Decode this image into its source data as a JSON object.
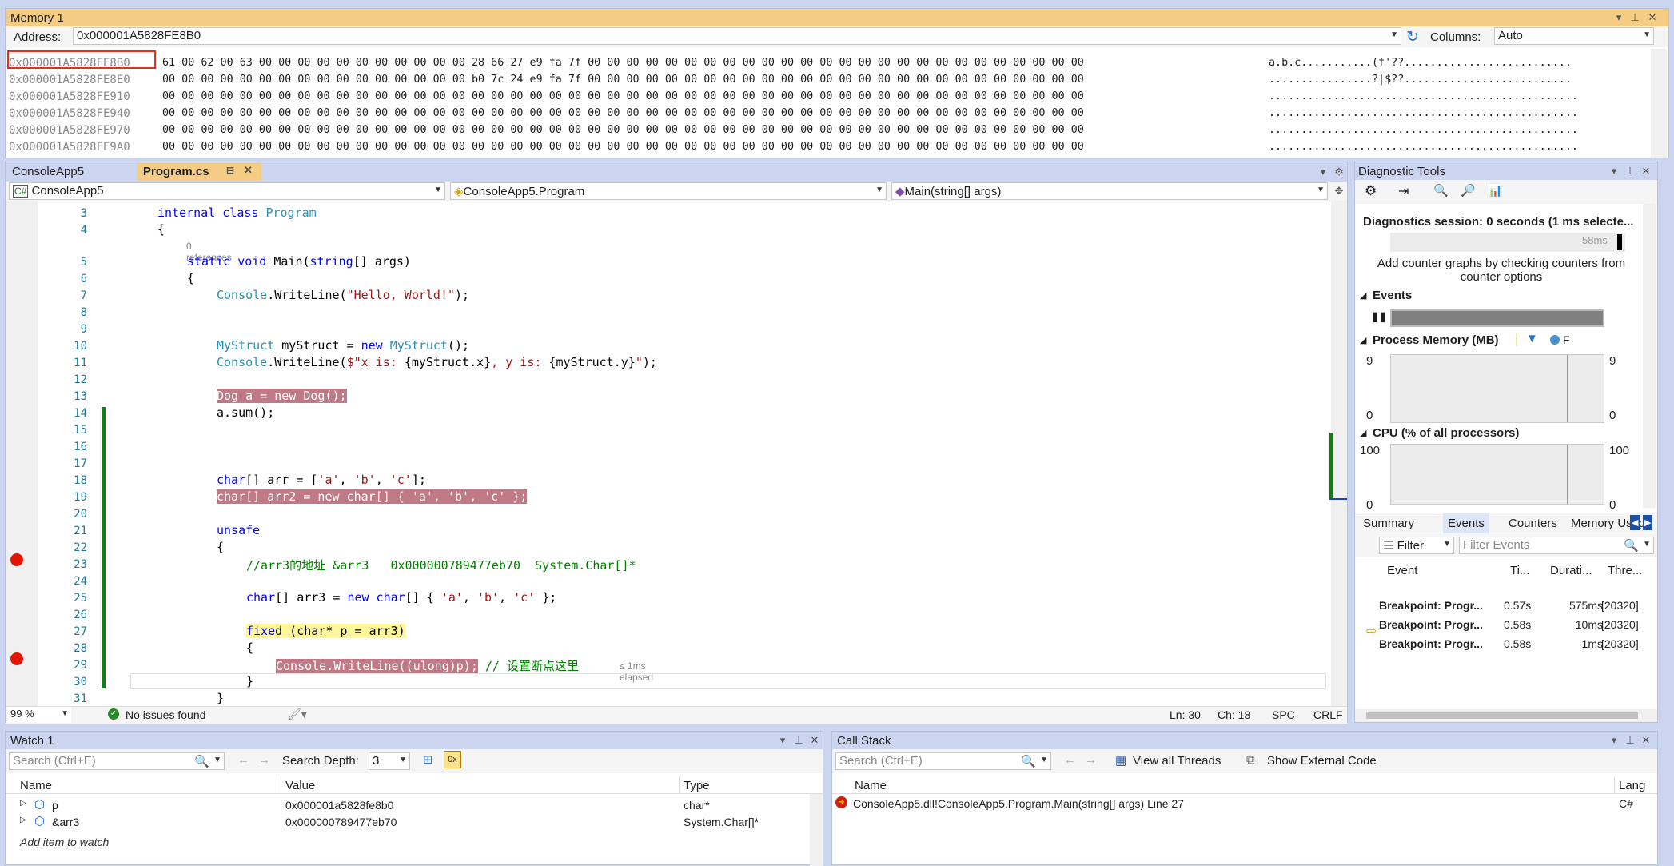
{
  "memory": {
    "title": "Memory 1",
    "address_label": "Address:",
    "address_value": "0x000001A5828FE8B0",
    "columns_label": "Columns:",
    "columns_value": "Auto",
    "rows": [
      {
        "addr": "0x000001A5828FE8B0",
        "bytes": "61 00 62 00 63 00 00 00 00 00 00 00 00 00 00 00 28 66 27 e9 fa 7f 00 00 00 00 00 00 00 00 00 00 00 00 00 00 00 00 00 00 00 00 00 00 00 00 00 00",
        "ascii": "a.b.c...........(f'??.........................."
      },
      {
        "addr": "0x000001A5828FE8E0",
        "bytes": "00 00 00 00 00 00 00 00 00 00 00 00 00 00 00 00 b0 7c 24 e9 fa 7f 00 00 00 00 00 00 00 00 00 00 00 00 00 00 00 00 00 00 00 00 00 00 00 00 00 00",
        "ascii": "................?|$??.........................."
      },
      {
        "addr": "0x000001A5828FE910",
        "bytes": "00 00 00 00 00 00 00 00 00 00 00 00 00 00 00 00 00 00 00 00 00 00 00 00 00 00 00 00 00 00 00 00 00 00 00 00 00 00 00 00 00 00 00 00 00 00 00 00",
        "ascii": "................................................"
      },
      {
        "addr": "0x000001A5828FE940",
        "bytes": "00 00 00 00 00 00 00 00 00 00 00 00 00 00 00 00 00 00 00 00 00 00 00 00 00 00 00 00 00 00 00 00 00 00 00 00 00 00 00 00 00 00 00 00 00 00 00 00",
        "ascii": "................................................"
      },
      {
        "addr": "0x000001A5828FE970",
        "bytes": "00 00 00 00 00 00 00 00 00 00 00 00 00 00 00 00 00 00 00 00 00 00 00 00 00 00 00 00 00 00 00 00 00 00 00 00 00 00 00 00 00 00 00 00 00 00 00 00",
        "ascii": "................................................"
      },
      {
        "addr": "0x000001A5828FE9A0",
        "bytes": "00 00 00 00 00 00 00 00 00 00 00 00 00 00 00 00 00 00 00 00 00 00 00 00 00 00 00 00 00 00 00 00 00 00 00 00 00 00 00 00 00 00 00 00 00 00 00 00",
        "ascii": "................................................"
      }
    ]
  },
  "editor": {
    "tabs": [
      {
        "label": "ConsoleApp5"
      },
      {
        "label": "Program.cs"
      }
    ],
    "nav_project": "ConsoleApp5",
    "nav_class": "ConsoleApp5.Program",
    "nav_member": "Main(string[] args)",
    "references": "0 references",
    "elapsed": "≤ 1ms elapsed",
    "zoom": "99 %",
    "issues": "No issues found",
    "ln": "Ln: 30",
    "ch": "Ch: 18",
    "spc": "SPC",
    "crlf": "CRLF",
    "lines": [
      {
        "n": "3",
        "parts": [
          [
            "kw",
            "internal class "
          ],
          [
            "ty",
            "Program"
          ]
        ],
        "indent": 0
      },
      {
        "n": "4",
        "parts": [
          [
            "",
            "{"
          ]
        ],
        "indent": 0
      },
      {
        "n": "5",
        "parts": [
          [
            "kw",
            "static void "
          ],
          [
            "",
            "Main("
          ],
          [
            "kw",
            "string"
          ],
          [
            "",
            "[] args)"
          ]
        ],
        "indent": 1
      },
      {
        "n": "6",
        "parts": [
          [
            "",
            "{"
          ]
        ],
        "indent": 1
      },
      {
        "n": "7",
        "parts": [
          [
            "ty",
            "Console"
          ],
          [
            "",
            ".WriteLine("
          ],
          [
            "st",
            "\"Hello, World!\""
          ],
          [
            "",
            ");"
          ]
        ],
        "indent": 2
      },
      {
        "n": "8",
        "parts": [],
        "indent": 2
      },
      {
        "n": "9",
        "parts": [],
        "indent": 2
      },
      {
        "n": "10",
        "parts": [
          [
            "ty",
            "MyStruct"
          ],
          [
            "",
            " myStruct = "
          ],
          [
            "kw",
            "new "
          ],
          [
            "ty",
            "MyStruct"
          ],
          [
            "",
            "();"
          ]
        ],
        "indent": 2
      },
      {
        "n": "11",
        "parts": [
          [
            "ty",
            "Console"
          ],
          [
            "",
            ".WriteLine("
          ],
          [
            "st",
            "$\"x is: "
          ],
          [
            "",
            "{myStruct.x}"
          ],
          [
            "st",
            ", y is: "
          ],
          [
            "",
            "{myStruct.y}"
          ],
          [
            "st",
            "\""
          ],
          [
            "",
            ");"
          ]
        ],
        "indent": 2
      },
      {
        "n": "12",
        "parts": [],
        "indent": 2
      },
      {
        "n": "13",
        "parts": [
          [
            "bpline",
            "Dog a = new Dog();"
          ]
        ],
        "indent": 2
      },
      {
        "n": "14",
        "parts": [
          [
            "",
            "a.sum();"
          ]
        ],
        "indent": 2
      },
      {
        "n": "15",
        "parts": [],
        "indent": 2
      },
      {
        "n": "16",
        "parts": [],
        "indent": 2
      },
      {
        "n": "17",
        "parts": [],
        "indent": 2
      },
      {
        "n": "18",
        "parts": [
          [
            "kw",
            "char"
          ],
          [
            "",
            "[] arr = ["
          ],
          [
            "st",
            "'a'"
          ],
          [
            ", ",
            ", "
          ],
          [
            "st",
            "'b'"
          ],
          [
            "",
            ", "
          ],
          [
            "st",
            "'c'"
          ],
          [
            "",
            "];"
          ]
        ],
        "indent": 2
      },
      {
        "n": "19",
        "parts": [
          [
            "bpline",
            "char[] arr2 = new char[] { 'a', 'b', 'c' };"
          ]
        ],
        "indent": 2
      },
      {
        "n": "20",
        "parts": [],
        "indent": 2
      },
      {
        "n": "21",
        "parts": [
          [
            "kw",
            "unsafe"
          ]
        ],
        "indent": 2
      },
      {
        "n": "22",
        "parts": [
          [
            "",
            "{"
          ]
        ],
        "indent": 2
      },
      {
        "n": "23",
        "parts": [
          [
            "cm",
            "//arr3的地址 &arr3   0x000000789477eb70  System.Char[]*"
          ]
        ],
        "indent": 3
      },
      {
        "n": "24",
        "parts": [],
        "indent": 3
      },
      {
        "n": "25",
        "parts": [
          [
            "kw",
            "char"
          ],
          [
            "",
            "[] arr3 = "
          ],
          [
            "kw",
            "new char"
          ],
          [
            "",
            "[] { "
          ],
          [
            "st",
            "'a'"
          ],
          [
            "",
            ", "
          ],
          [
            "st",
            "'b'"
          ],
          [
            "",
            ", "
          ],
          [
            "st",
            "'c'"
          ],
          [
            "",
            " };"
          ]
        ],
        "indent": 3
      },
      {
        "n": "26",
        "parts": [],
        "indent": 3
      },
      {
        "n": "27",
        "parts": [
          [
            "kw",
            "fixe"
          ],
          [
            "",
            "d (char* p = arr3)"
          ]
        ],
        "indent": 3
      },
      {
        "n": "28",
        "parts": [
          [
            "",
            "{"
          ]
        ],
        "indent": 3
      },
      {
        "n": "29",
        "parts": [
          [
            "bpline",
            "Console.WriteLine((ulong)p);"
          ],
          [
            "cm",
            " // 设置断点这里"
          ]
        ],
        "indent": 4
      },
      {
        "n": "30",
        "parts": [
          [
            "",
            "}"
          ]
        ],
        "indent": 3
      },
      {
        "n": "31",
        "parts": [
          [
            "",
            "}"
          ]
        ],
        "indent": 2
      }
    ]
  },
  "diagnostics": {
    "title": "Diagnostic Tools",
    "session": "Diagnostics session: 0 seconds (1 ms selecte...",
    "timeline_tick": "58ms",
    "counter_hint": "Add counter graphs by checking counters from counter options",
    "events_label": "Events",
    "memory_label": "Process Memory (MB)",
    "memory_legend_f": "F",
    "mem_max": "9",
    "mem_min": "0",
    "cpu_label": "CPU (% of all processors)",
    "cpu_max": "100",
    "cpu_min": "0",
    "tabs": [
      "Summary",
      "Events",
      "Counters",
      "Memory Usage"
    ],
    "filter_label": "Filter",
    "filter_placeholder": "Filter Events",
    "columns": [
      "Event",
      "Ti...",
      "Durati...",
      "Thre..."
    ],
    "events": [
      {
        "event": "Breakpoint: Progr...",
        "time": "0.57s",
        "duration": "575ms",
        "thread": "[20320]"
      },
      {
        "event": "Breakpoint: Progr...",
        "time": "0.58s",
        "duration": "10ms",
        "thread": "[20320]"
      },
      {
        "event": "Breakpoint: Progr...",
        "time": "0.58s",
        "duration": "1ms",
        "thread": "[20320]"
      }
    ]
  },
  "watch": {
    "title": "Watch 1",
    "search_placeholder": "Search (Ctrl+E)",
    "depth_label": "Search Depth:",
    "depth_value": "3",
    "columns": [
      "Name",
      "Value",
      "Type"
    ],
    "rows": [
      {
        "name": "p",
        "value": "0x000001a5828fe8b0",
        "type": "char*"
      },
      {
        "name": "&arr3",
        "value": "0x000000789477eb70",
        "type": "System.Char[]*"
      }
    ],
    "add_item": "Add item to watch"
  },
  "callstack": {
    "title": "Call Stack",
    "search_placeholder": "Search (Ctrl+E)",
    "view_threads": "View all Threads",
    "external_code": "Show External Code",
    "columns": [
      "Name",
      "Lang"
    ],
    "frames": [
      {
        "name": "ConsoleApp5.dll!ConsoleApp5.Program.Main(string[] args) Line 27",
        "lang": "C#"
      }
    ]
  },
  "colors": {
    "accent": "#f5cc84",
    "tool_header": "#ffeba0",
    "breakpoint": "#e51400",
    "chrome": "#ccd5f0"
  }
}
